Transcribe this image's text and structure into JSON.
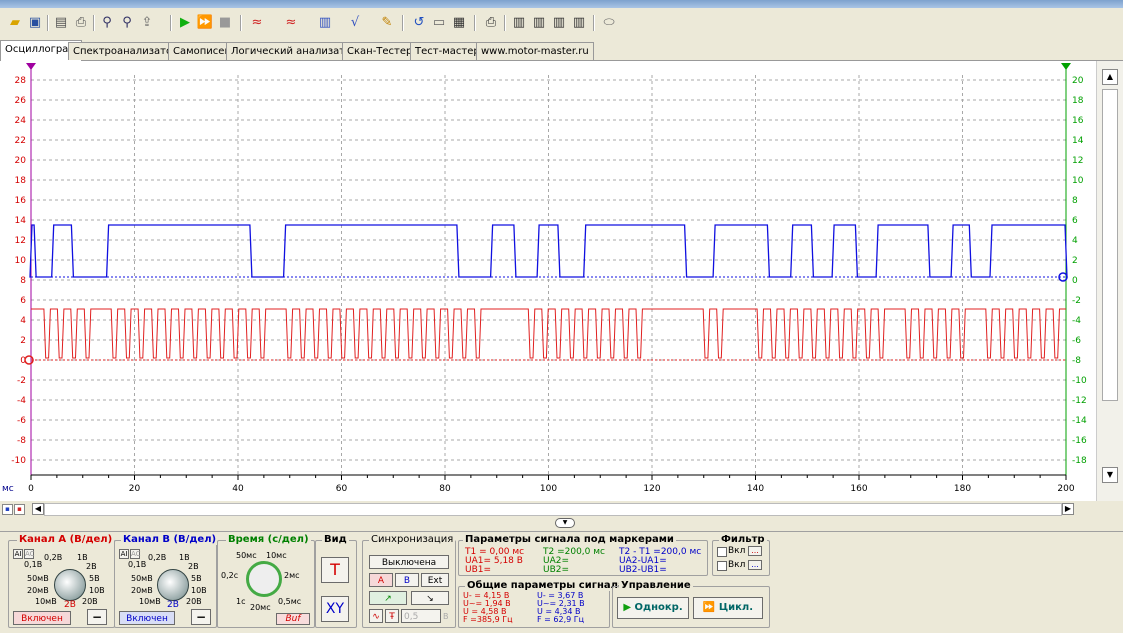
{
  "colors": {
    "channel_a": "#e02020",
    "channel_b": "#1010e0",
    "right_axis": "#00a000",
    "left_axis": "#d40000"
  },
  "toolbar": {
    "icons": [
      "open-folder-icon",
      "save-icon",
      "print-preview-icon",
      "print-icon",
      "zoom-in-icon",
      "zoom-out-icon",
      "export-icon",
      "play-icon",
      "fast-play-icon",
      "stop-icon",
      "signal-a-icon",
      "signal-b-icon",
      "channel-color-icon",
      "formula-icon",
      "probe-icon",
      "refresh-icon",
      "monitor-icon",
      "calculator-icon",
      "printer-icon",
      "memory-1-icon",
      "memory-2-icon",
      "memory-3-icon",
      "memory-4-icon",
      "eraser-icon"
    ]
  },
  "tabs": [
    {
      "label": "Осциллограф",
      "active": true
    },
    {
      "label": "Спектроанализатор"
    },
    {
      "label": "Самописец"
    },
    {
      "label": "Логический анализатор"
    },
    {
      "label": "Скан-Тестер"
    },
    {
      "label": "Тест-мастер"
    },
    {
      "label": "www.motor-master.ru"
    }
  ],
  "chart_data": {
    "type": "line",
    "xlabel": "мс",
    "xlim": [
      0,
      200
    ],
    "x_ticks": [
      "0",
      "20",
      "40",
      "60",
      "80",
      "100",
      "120",
      "140",
      "160",
      "180",
      "200"
    ],
    "y_left_ticks": [
      "28",
      "26",
      "24",
      "22",
      "20",
      "18",
      "16",
      "14",
      "12",
      "10",
      "8",
      "6",
      "4",
      "2",
      "0",
      "-2",
      "-4",
      "-6",
      "-8",
      "-10"
    ],
    "y_right_ticks": [
      "20",
      "18",
      "16",
      "14",
      "12",
      "10",
      "8",
      "6",
      "4",
      "2",
      "0",
      "-2",
      "-4",
      "-6",
      "-8",
      "-10",
      "-12",
      "-14",
      "-16",
      "-18"
    ],
    "ylim_left": [
      -11.5,
      28.5
    ],
    "ylim_right": [
      -19.5,
      20.5
    ],
    "grid": true,
    "series": [
      {
        "name": "Канал B",
        "color": "#1010e0",
        "low": 0,
        "high": 5.2,
        "high_intervals": [
          [
            0,
            0.8
          ],
          [
            4.2,
            8
          ],
          [
            14.8,
            42.5
          ],
          [
            49,
            82.5
          ],
          [
            89,
            93.5
          ],
          [
            98,
            102
          ],
          [
            107,
            126.5
          ],
          [
            127,
            127
          ],
          [
            132,
            142.5
          ],
          [
            147,
            151
          ],
          [
            155,
            159.5
          ],
          [
            163.5,
            173.5
          ],
          [
            178,
            181.5
          ],
          [
            185.5,
            200
          ]
        ]
      },
      {
        "name": "Канал A",
        "color": "#e02020",
        "low": 0.2,
        "high": 5.1,
        "burst_gaps": [
          [
            12,
            14.8
          ],
          [
            46,
            48.5
          ],
          [
            89,
            93.5
          ],
          [
            119,
            128.5
          ],
          [
            136,
            138.5
          ],
          [
            165,
            168
          ],
          [
            181,
            183.5
          ]
        ],
        "period_ms": 2.6
      }
    ]
  },
  "channel_a": {
    "title": "Канал А (В/дел)",
    "scales": [
      "0,1В",
      "0,2В",
      "1В",
      "2В",
      "5В",
      "10В",
      "20В",
      "50мВ",
      "20мВ",
      "10мВ"
    ],
    "selected": "2В",
    "mode_ai": "AI",
    "mode_ac": "AC",
    "enable_label": "Включен"
  },
  "channel_b": {
    "title": "Канал В (В/дел)",
    "scales": [
      "0,1В",
      "0,2В",
      "1В",
      "2В",
      "5В",
      "10В",
      "20В",
      "50мВ",
      "20мВ",
      "10мВ"
    ],
    "selected": "2В",
    "mode_ai": "AI",
    "mode_ac": "AC",
    "enable_label": "Включен"
  },
  "time": {
    "title": "Время (с/дел)",
    "scales": [
      "50мс",
      "10мс",
      "2мс",
      "0,5мс",
      "20мс",
      "1с",
      "0,2с"
    ],
    "buf_label": "Buf"
  },
  "view": {
    "title": "Вид",
    "t_label": "T",
    "xy_label": "XY"
  },
  "sync": {
    "title": "Синхронизация",
    "state": "Выключена",
    "a": "A",
    "b": "B",
    "ext": "Ext",
    "level": "0,5",
    "level_unit": "В"
  },
  "markers": {
    "title": "Параметры сигнала под маркерами",
    "t1": "T1 = 0,00 мс",
    "t2": "T2 =200,0 мс",
    "dt": "T2 - T1 =200,0 мс",
    "ua1": "UA1= 5,18 В",
    "ua2": "UA2=",
    "dua": "UA2-UA1=",
    "ub1": "UB1=",
    "ub2": "UB2=",
    "dub": "UB2-UB1="
  },
  "general": {
    "title": "Общие параметры сигнала",
    "a": [
      "U- = 4,15 В",
      "U~= 1,94 В",
      "U = 4,58 В",
      "F =385,9 Гц"
    ],
    "b": [
      "U- = 3,67 В",
      "U~= 2,31 В",
      "U = 4,34 В",
      "F = 62,9 Гц"
    ]
  },
  "filter": {
    "title": "Фильтр",
    "on1": "Вкл",
    "on2": "Вкл",
    "more": "..."
  },
  "control": {
    "title": "Управление",
    "single": "Однокр.",
    "cycle": "Цикл."
  }
}
